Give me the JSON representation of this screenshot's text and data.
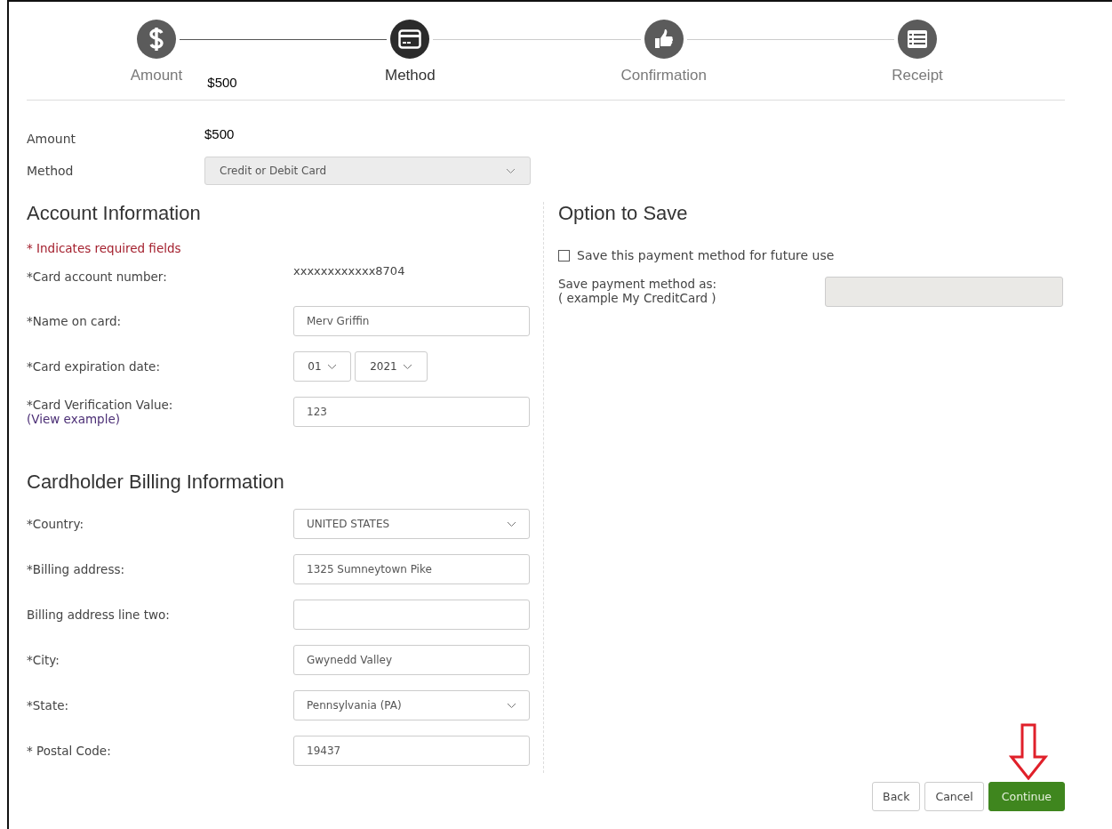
{
  "steps": [
    {
      "label": "Amount",
      "selected": false,
      "note": "$500"
    },
    {
      "label": "Method",
      "selected": true
    },
    {
      "label": "Confirmation",
      "selected": false
    },
    {
      "label": "Receipt",
      "selected": false
    }
  ],
  "summary": {
    "amount_label": "Amount",
    "amount": "$500",
    "method_label": "Method",
    "method": "Credit or Debit Card"
  },
  "account": {
    "heading": "Account Information",
    "required_note": "* Indicates required fields",
    "fields": [
      {
        "kind": "static",
        "label": "*Card account number:",
        "value": "xxxxxxxxxxxx8704"
      },
      {
        "kind": "input",
        "label": "*Name on card:",
        "value": "Merv Griffin"
      },
      {
        "kind": "expiry",
        "label": "*Card expiration date:",
        "month": "01",
        "year": "2021"
      },
      {
        "kind": "input",
        "label": "*Card Verification Value:",
        "value": "123",
        "link": "(View example)"
      }
    ]
  },
  "billing": {
    "heading": "Cardholder Billing Information",
    "fields": [
      {
        "kind": "select",
        "label": "*Country:",
        "value": "UNITED STATES"
      },
      {
        "kind": "input",
        "label": "*Billing address:",
        "value": "1325 Sumneytown Pike"
      },
      {
        "kind": "input",
        "label": "Billing address line two:"
      },
      {
        "kind": "input",
        "label": "*City:",
        "value": "Gwynedd Valley"
      },
      {
        "kind": "select",
        "label": "*State:",
        "value": "Pennsylvania (PA)"
      },
      {
        "kind": "input",
        "label": "* Postal Code:",
        "value": "19437"
      }
    ]
  },
  "save": {
    "heading": "Option to Save",
    "checkbox_label": "Save this payment method for future use",
    "checked": false,
    "name_label": "Save payment method as:",
    "name_hint": "( example My CreditCard )",
    "disabled": true
  },
  "buttons": [
    {
      "label": "Back",
      "kind": "default"
    },
    {
      "label": "Cancel",
      "kind": "default"
    },
    {
      "label": "Continue",
      "kind": "primary"
    }
  ]
}
